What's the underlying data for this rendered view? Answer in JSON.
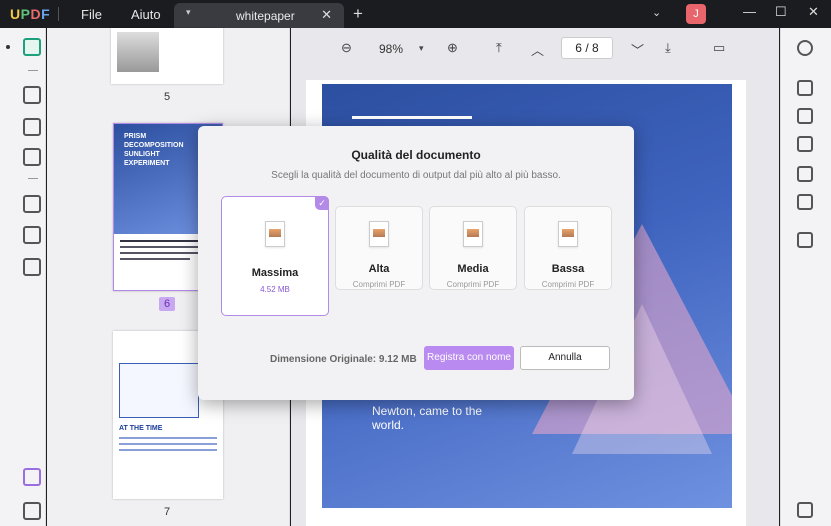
{
  "titlebar": {
    "logo": {
      "u": "U",
      "p": "P",
      "d": "D",
      "f": "F"
    },
    "menu": [
      "File",
      "Aiuto"
    ],
    "tab_label": "whitepaper",
    "avatar_initial": "J"
  },
  "thumbnails": {
    "pages": [
      {
        "number": "5",
        "selected": false
      },
      {
        "number": "6",
        "selected": true,
        "title": "PRISM DECOMPOSITION SUNLIGHT EXPERIMENT"
      },
      {
        "number": "7",
        "selected": false,
        "heading": "AT THE TIME"
      }
    ]
  },
  "toolbar": {
    "zoom": "98%",
    "current_page": "6",
    "page_separator": "/",
    "total_pages": "8"
  },
  "document": {
    "visible_text_line1": "Newton, came to the",
    "visible_text_line2": "world."
  },
  "dialog": {
    "title": "Qualità del documento",
    "subtitle": "Scegli la qualità del documento di output dal più alto al più basso.",
    "options": [
      {
        "label": "Massima",
        "desc": "4.52 MB",
        "selected": true
      },
      {
        "label": "Alta",
        "desc": "Comprimi PDF",
        "selected": false
      },
      {
        "label": "Media",
        "desc": "Comprimi PDF",
        "selected": false
      },
      {
        "label": "Bassa",
        "desc": "Comprimi PDF",
        "selected": false
      }
    ],
    "original_size": "Dimensione Originale: 9.12 MB",
    "save_button": "Registra con nome",
    "cancel_button": "Annulla"
  },
  "colors": {
    "accent": "#b38ae8",
    "brand_green": "#1da07c"
  }
}
